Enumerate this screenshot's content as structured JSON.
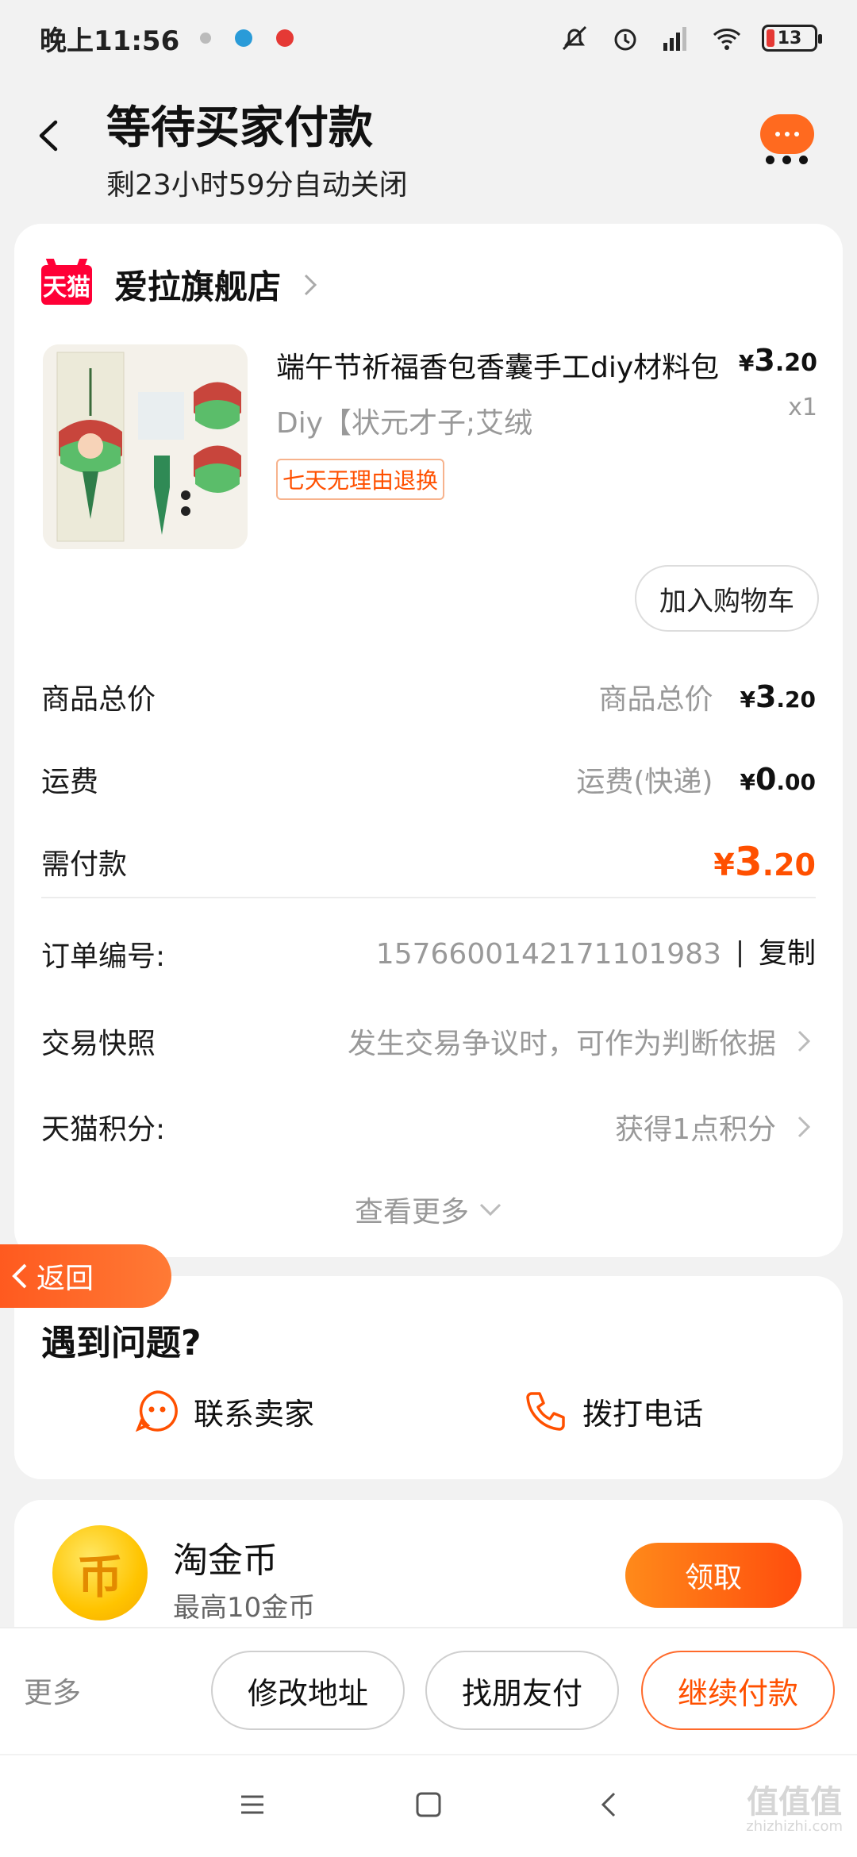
{
  "status_bar": {
    "time": "晚上11:56",
    "battery": "13"
  },
  "header": {
    "title": "等待买家付款",
    "subtitle": "剩23小时59分自动关闭"
  },
  "store": {
    "badge": "天猫",
    "name": "爱拉旗舰店"
  },
  "product": {
    "title": "端午节祈福香包香囊手工diy材料包",
    "sku": "Diy【状元才子;艾绒",
    "return_tag": "七天无理由退换",
    "price_symbol": "¥",
    "price_int": "3",
    "price_dec": ".20",
    "qty": "x1",
    "add_cart": "加入购物车"
  },
  "summary": {
    "goods_total_label": "商品总价",
    "goods_total_desc": "商品总价",
    "goods_total_int": "3",
    "goods_total_dec": ".20",
    "shipping_label": "运费",
    "shipping_desc": "运费(快递)",
    "shipping_int": "0",
    "shipping_dec": ".00",
    "due_label": "需付款",
    "due_int": "3",
    "due_dec": ".20",
    "currency": "¥"
  },
  "order": {
    "number_label": "订单编号:",
    "number_value": "1576600142171101983",
    "copy_label": "复制",
    "snapshot_label": "交易快照",
    "snapshot_value": "发生交易争议时，可作为判断依据",
    "points_label": "天猫积分:",
    "points_value": "获得1点积分",
    "see_more": "查看更多"
  },
  "float_return": "返回",
  "help": {
    "title": "遇到问题?",
    "contact_seller": "联系卖家",
    "call": "拨打电话"
  },
  "coin": {
    "glyph": "币",
    "title": "淘金币",
    "subtitle": "最高10金币",
    "claim": "领取"
  },
  "actions": {
    "more": "更多",
    "modify_address": "修改地址",
    "friend_pay": "找朋友付",
    "continue_pay": "继续付款"
  },
  "watermark": {
    "big": "值值值",
    "small": "zhizhizhi.com"
  },
  "colors": {
    "accent": "#ff5000",
    "tmall": "#ff0036",
    "background": "#f2f2f2"
  }
}
